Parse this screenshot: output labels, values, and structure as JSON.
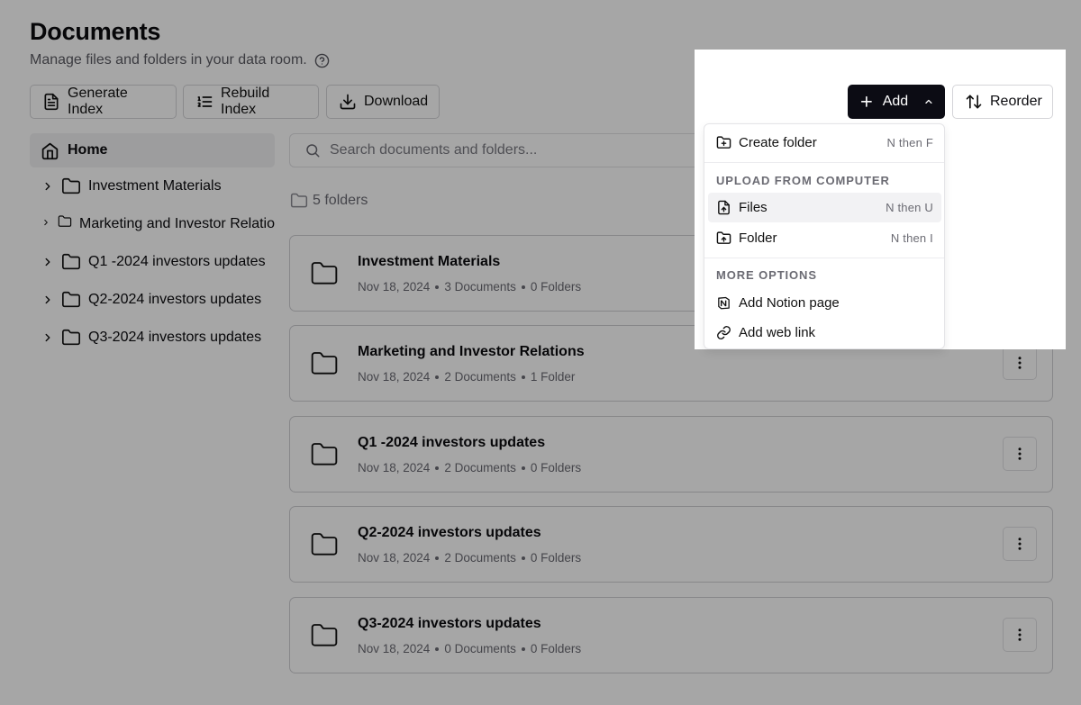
{
  "header": {
    "title": "Documents",
    "subtitle": "Manage files and folders in your data room."
  },
  "toolbar": {
    "generate_index": "Generate Index",
    "rebuild_index": "Rebuild Index",
    "download": "Download",
    "add": "Add",
    "reorder": "Reorder"
  },
  "sidebar": {
    "home": "Home",
    "items": [
      {
        "label": "Investment Materials"
      },
      {
        "label": "Marketing and Investor Relatio"
      },
      {
        "label": "Q1 -2024 investors updates"
      },
      {
        "label": "Q2-2024 investors updates"
      },
      {
        "label": "Q3-2024 investors updates"
      }
    ]
  },
  "search": {
    "placeholder": "Search documents and folders..."
  },
  "summary": {
    "folder_count": "5 folders"
  },
  "folders": [
    {
      "name": "Investment Materials",
      "date": "Nov 18, 2024",
      "documents": "3 Documents",
      "subfolders": "0 Folders"
    },
    {
      "name": "Marketing and Investor Relations",
      "date": "Nov 18, 2024",
      "documents": "2 Documents",
      "subfolders": "1 Folder"
    },
    {
      "name": "Q1 -2024 investors updates",
      "date": "Nov 18, 2024",
      "documents": "2 Documents",
      "subfolders": "0 Folders"
    },
    {
      "name": "Q2-2024 investors updates",
      "date": "Nov 18, 2024",
      "documents": "2 Documents",
      "subfolders": "0 Folders"
    },
    {
      "name": "Q3-2024 investors updates",
      "date": "Nov 18, 2024",
      "documents": "0 Documents",
      "subfolders": "0 Folders"
    }
  ],
  "add_menu": {
    "create_folder": {
      "label": "Create folder",
      "shortcut": "N then F"
    },
    "upload_heading": "UPLOAD FROM COMPUTER",
    "files": {
      "label": "Files",
      "shortcut": "N then U"
    },
    "folder": {
      "label": "Folder",
      "shortcut": "N then I"
    },
    "more_heading": "MORE OPTIONS",
    "notion": {
      "label": "Add Notion page"
    },
    "web_link": {
      "label": "Add web link"
    }
  },
  "colors": {
    "primary_button": "#0c0c14",
    "overlay": "rgba(0,0,0,0.35)",
    "selected_bg": "#f2f2f3"
  },
  "icons": {
    "help": "help-circle-icon",
    "generate": "file-text-icon",
    "rebuild": "list-ordered-icon",
    "download": "download-icon",
    "home": "home-icon",
    "folder": "folder-icon",
    "chevron": "chevron-right-icon",
    "search": "search-icon",
    "more": "more-vertical-icon",
    "add": "plus-icon",
    "reorder": "arrow-up-down-icon",
    "create_folder": "folder-plus-icon",
    "file_upload": "file-up-icon",
    "folder_upload": "folder-up-icon",
    "notion": "notion-icon",
    "link": "link-icon"
  }
}
